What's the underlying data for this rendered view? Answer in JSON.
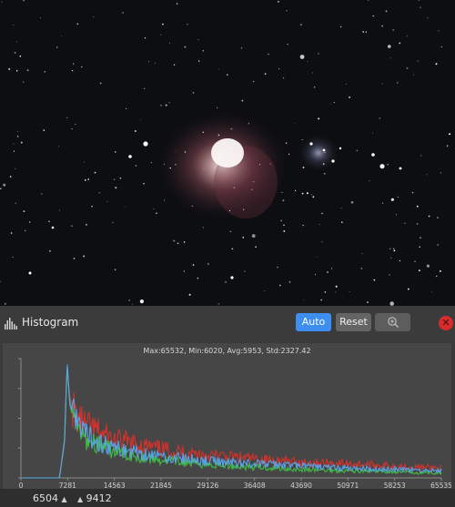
{
  "histogram": {
    "title": "Histogram",
    "buttons": {
      "auto": "Auto",
      "reset": "Reset"
    },
    "stats": "Max:65532, Min:6020, Avg:5953, Std:2327.42",
    "footer": {
      "min_value": "6504",
      "max_value": "9412"
    }
  },
  "icons": [
    "histogram-icon",
    "zoom-icon",
    "close-icon",
    "min-marker-icon",
    "max-marker-icon"
  ],
  "colors": {
    "accent": "#3e8ef0",
    "red_channel": "#d9322a",
    "green_channel": "#3fc43f",
    "blue_channel": "#5aa6f0",
    "close": "#d72c2c"
  },
  "chart_data": {
    "type": "line",
    "title": "",
    "xlabel": "",
    "ylabel": "",
    "x_ticks": [
      0,
      7281,
      14563,
      21845,
      29126,
      36408,
      43690,
      50971,
      58253,
      65535
    ],
    "xlim": [
      0,
      65535
    ],
    "ylim": [
      0,
      1
    ],
    "series": [
      {
        "color": "#d9322a",
        "x": [
          0,
          6000,
          6800,
          7200,
          7600,
          8500,
          10000,
          14563,
          21845,
          29126,
          36408,
          43690,
          50971,
          58253,
          65535
        ],
        "values": [
          0,
          0,
          0.3,
          0.93,
          0.68,
          0.52,
          0.44,
          0.32,
          0.24,
          0.19,
          0.16,
          0.13,
          0.12,
          0.1,
          0.08
        ]
      },
      {
        "color": "#3fc43f",
        "x": [
          0,
          6000,
          6800,
          7200,
          7600,
          8500,
          10000,
          14563,
          21845,
          29126,
          36408,
          43690,
          50971,
          58253,
          65535
        ],
        "values": [
          0,
          0,
          0.3,
          0.95,
          0.62,
          0.42,
          0.33,
          0.22,
          0.15,
          0.11,
          0.09,
          0.07,
          0.06,
          0.05,
          0.04
        ]
      },
      {
        "color": "#5aa6f0",
        "x": [
          0,
          6000,
          6800,
          7200,
          7600,
          8500,
          10000,
          14563,
          21845,
          29126,
          36408,
          43690,
          50971,
          58253,
          65535
        ],
        "values": [
          0,
          0,
          0.32,
          0.98,
          0.64,
          0.46,
          0.36,
          0.25,
          0.18,
          0.14,
          0.12,
          0.1,
          0.08,
          0.07,
          0.06
        ]
      }
    ]
  }
}
